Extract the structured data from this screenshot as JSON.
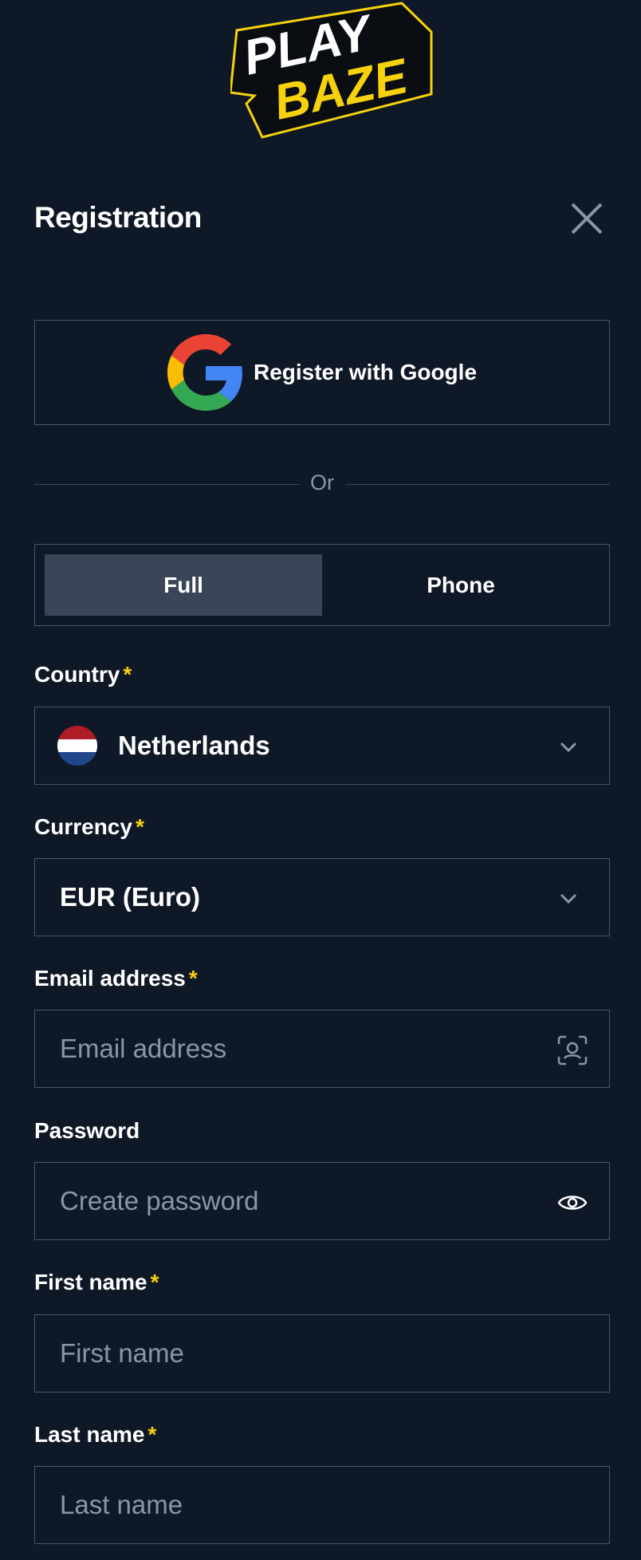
{
  "brand": {
    "logo_line1": "PLAY",
    "logo_line2": "BAZE",
    "yellow": "#f5d20c"
  },
  "header": {
    "title": "Registration"
  },
  "google": {
    "label": "Register with Google"
  },
  "divider": {
    "text": "Or"
  },
  "tabs": [
    {
      "label": "Full",
      "active": true
    },
    {
      "label": "Phone",
      "active": false
    }
  ],
  "country": {
    "label": "Country",
    "required_mark": "*",
    "value": "Netherlands",
    "flag_icon": "netherlands-flag-icon"
  },
  "currency": {
    "label": "Currency",
    "required_mark": "*",
    "value": "EUR (Euro)"
  },
  "email": {
    "label": "Email address",
    "required_mark": "*",
    "placeholder": "Email address"
  },
  "password": {
    "label": "Password",
    "placeholder": "Create password"
  },
  "first_name": {
    "label": "First name",
    "required_mark": "*",
    "placeholder": "First name"
  },
  "last_name": {
    "label": "Last name",
    "required_mark": "*",
    "placeholder": "Last name"
  }
}
